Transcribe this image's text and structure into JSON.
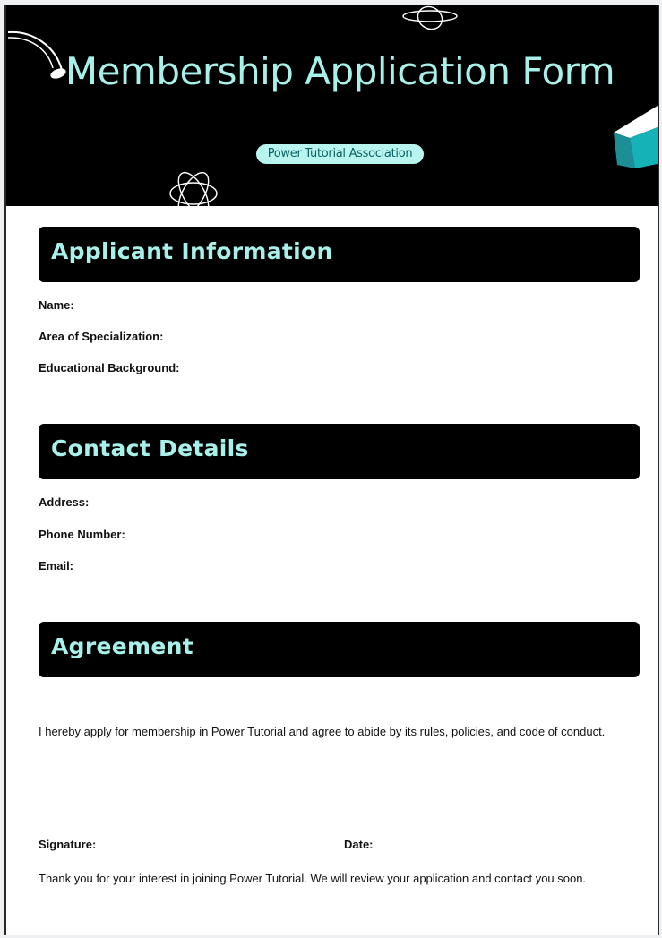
{
  "header": {
    "title": "Membership Application Form",
    "badge": "Power Tutorial Association",
    "accent_color": "#a8f0ea",
    "background": "#000000"
  },
  "sections": {
    "applicant": {
      "title": "Applicant Information",
      "fields": [
        "Name:",
        "Area of Specialization:",
        "Educational Background:"
      ]
    },
    "contact": {
      "title": "Contact Details",
      "fields": [
        "Address:",
        "Phone Number:",
        "Email:"
      ]
    },
    "agreement": {
      "title": "Agreement",
      "text": "I hereby apply for membership in Power Tutorial and agree to abide by its rules, policies, and code of conduct."
    }
  },
  "signature": {
    "signature_label": "Signature:",
    "date_label": "Date:"
  },
  "footer": {
    "thank_you": "Thank you for your interest in joining Power Tutorial. We will review your application and contact you soon."
  },
  "icons": [
    "swoosh-icon",
    "ring-icon",
    "atom-icon",
    "cube-icon"
  ]
}
